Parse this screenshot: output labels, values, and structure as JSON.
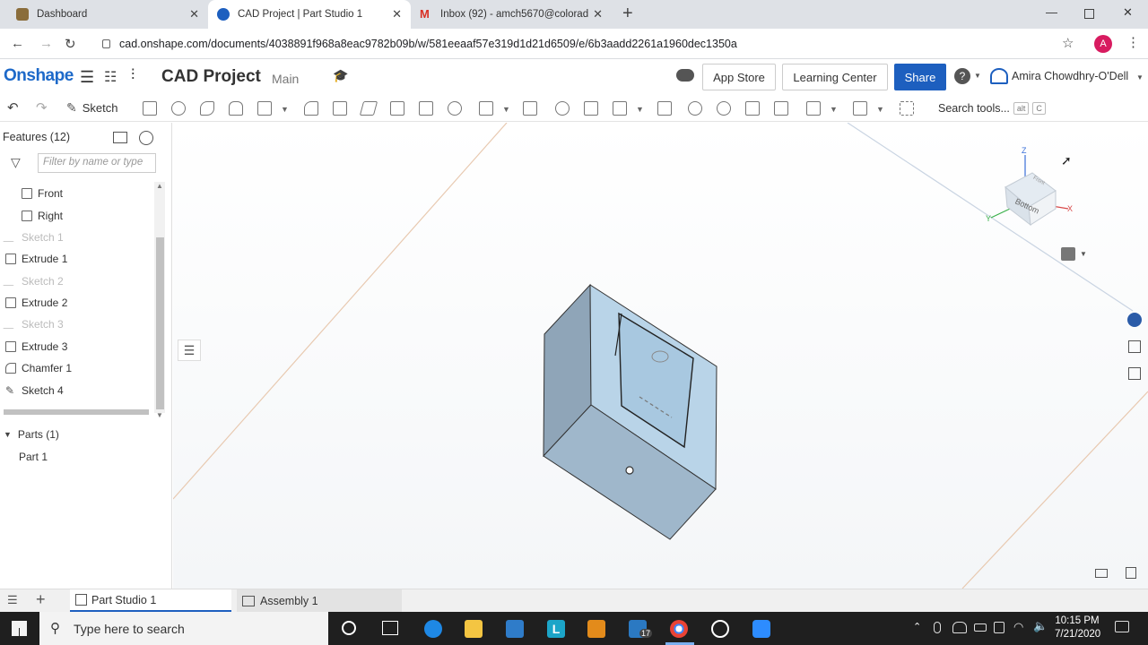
{
  "browser": {
    "tabs": [
      {
        "title": "Dashboard",
        "color": "#5f6368"
      },
      {
        "title": "CAD Project | Part Studio 1",
        "color": "#1d5fbf"
      },
      {
        "title": "Inbox (92) - amch5670@colorad",
        "color": "#d93025"
      }
    ],
    "new_tab": "+",
    "url": "cad.onshape.com/documents/4038891f968a8eac9782b09b/w/581eeaaf57e319d1d21d6509/e/6b3aadd2261a1960dec1350a",
    "profile_initial": "A"
  },
  "header": {
    "logo": "Onshape",
    "doc_title": "CAD Project",
    "branch": "Main",
    "app_store": "App Store",
    "learning_center": "Learning Center",
    "share": "Share",
    "user": "Amira Chowdhry-O'Dell",
    "accent": "#1d5fbf"
  },
  "toolbar": {
    "sketch": "Sketch",
    "search_tools": "Search tools...",
    "shortcut_alt": "alt",
    "shortcut_key": "C"
  },
  "features": {
    "title": "Features (12)",
    "filter_placeholder": "Filter by name or type",
    "items": [
      {
        "label": "Front",
        "kind": "plane"
      },
      {
        "label": "Right",
        "kind": "plane"
      },
      {
        "label": "Sketch 1",
        "kind": "sketch-hidden"
      },
      {
        "label": "Extrude 1",
        "kind": "extrude"
      },
      {
        "label": "Sketch 2",
        "kind": "sketch-hidden"
      },
      {
        "label": "Extrude 2",
        "kind": "extrude"
      },
      {
        "label": "Sketch 3",
        "kind": "sketch-hidden"
      },
      {
        "label": "Extrude 3",
        "kind": "extrude"
      },
      {
        "label": "Chamfer 1",
        "kind": "chamfer"
      },
      {
        "label": "Sketch 4",
        "kind": "sketch"
      }
    ],
    "parts_header": "Parts (1)",
    "parts": [
      "Part 1"
    ]
  },
  "viewcube": {
    "z": "Z",
    "y": "Y",
    "x": "X",
    "face": "Bottom",
    "face_small": "Front"
  },
  "bottom_tabs": [
    {
      "label": "Part Studio 1",
      "active": true
    },
    {
      "label": "Assembly 1",
      "active": false
    }
  ],
  "taskbar": {
    "search_placeholder": "Type here to search",
    "time": "10:15 PM",
    "date": "7/21/2020",
    "mail_badge": "17"
  }
}
